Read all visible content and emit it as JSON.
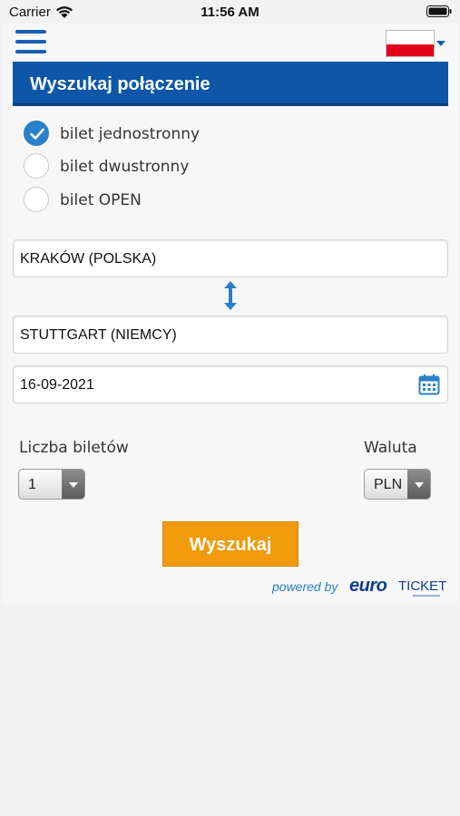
{
  "status_bar": {
    "carrier": "Carrier",
    "time": "11:56 AM"
  },
  "header": {
    "language_flag": "poland-flag"
  },
  "banner": {
    "title": "Wyszukaj połączenie"
  },
  "ticket_types": [
    {
      "label": "bilet jednostronny",
      "checked": true
    },
    {
      "label": "bilet dwustronny",
      "checked": false
    },
    {
      "label": "bilet OPEN",
      "checked": false
    }
  ],
  "form": {
    "from": "KRAKÓW (POLSKA)",
    "to": "STUTTGART (NIEMCY)",
    "date": "16-09-2021",
    "tickets_label": "Liczba biletów",
    "tickets_value": "1",
    "currency_label": "Waluta",
    "currency_value": "PLN",
    "search_button": "Wyszukaj"
  },
  "footer": {
    "powered_by": "powered by",
    "logo_text_bold": "euro",
    "logo_text": "TICKET"
  },
  "colors": {
    "brand_blue": "#0d56a8",
    "accent_orange": "#f09a0c",
    "link_blue": "#2a7fc9"
  }
}
